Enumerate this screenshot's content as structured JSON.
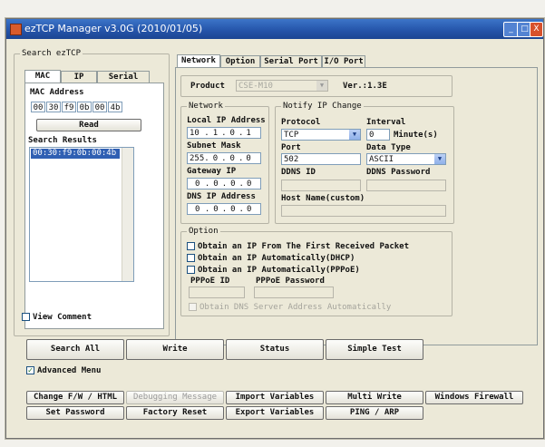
{
  "title": "ezTCP Manager v3.0G (2010/01/05)",
  "window_buttons": [
    "_",
    "□",
    "X"
  ],
  "search": {
    "group_label": "Search ezTCP",
    "tabs": [
      "MAC",
      "IP",
      "Serial"
    ],
    "mac_label": "MAC Address",
    "mac_octets": [
      "00",
      "30",
      "f9",
      "0b",
      "00",
      "4b"
    ],
    "read_label": "Read",
    "results_label": "Search Results",
    "results": [
      "00:30:f9:0b:00:4b"
    ],
    "view_comment_label": "View Comment"
  },
  "main_tabs": [
    "Network",
    "Option",
    "Serial Port",
    "I/O Port"
  ],
  "product": {
    "label": "Product",
    "value": "CSE-M10",
    "version": "Ver.:1.3E"
  },
  "network": {
    "group_label": "Network",
    "local_ip_label": "Local IP Address",
    "local_ip": [
      "10",
      "1",
      "0",
      "1"
    ],
    "subnet_label": "Subnet Mask",
    "subnet": [
      "255",
      "0",
      "0",
      "0"
    ],
    "gateway_label": "Gateway IP",
    "gateway": [
      "0",
      "0",
      "0",
      "0"
    ],
    "dns_label": "DNS IP Address",
    "dns": [
      "0",
      "0",
      "0",
      "0"
    ]
  },
  "notify": {
    "group_label": "Notify IP Change",
    "protocol_label": "Protocol",
    "protocol_value": "TCP",
    "interval_label": "Interval",
    "interval_value": "0",
    "interval_unit": "Minute(s)",
    "port_label": "Port",
    "port_value": "502",
    "data_type_label": "Data Type",
    "data_type_value": "ASCII",
    "ddns_id_label": "DDNS ID",
    "ddns_pw_label": "DDNS Password",
    "host_label": "Host Name(custom)"
  },
  "option": {
    "group_label": "Option",
    "opt1": "Obtain an IP From The First Received Packet",
    "opt2": "Obtain an IP Automatically(DHCP)",
    "opt3": "Obtain an IP Automatically(PPPoE)",
    "pppoe_id_label": "PPPoE ID",
    "pppoe_pw_label": "PPPoE Password",
    "opt_dns": "Obtain DNS Server Address Automatically"
  },
  "buttons": {
    "search_all": "Search All",
    "write": "Write",
    "status": "Status",
    "simple_test": "Simple Test",
    "advanced_menu": "Advanced Menu",
    "change_fw": "Change F/W / HTML",
    "debugging": "Debugging Message",
    "import_vars": "Import Variables",
    "multi_write": "Multi Write",
    "windows_firewall": "Windows Firewall",
    "set_password": "Set Password",
    "factory_reset": "Factory Reset",
    "export_vars": "Export Variables",
    "ping_arp": "PING / ARP"
  }
}
